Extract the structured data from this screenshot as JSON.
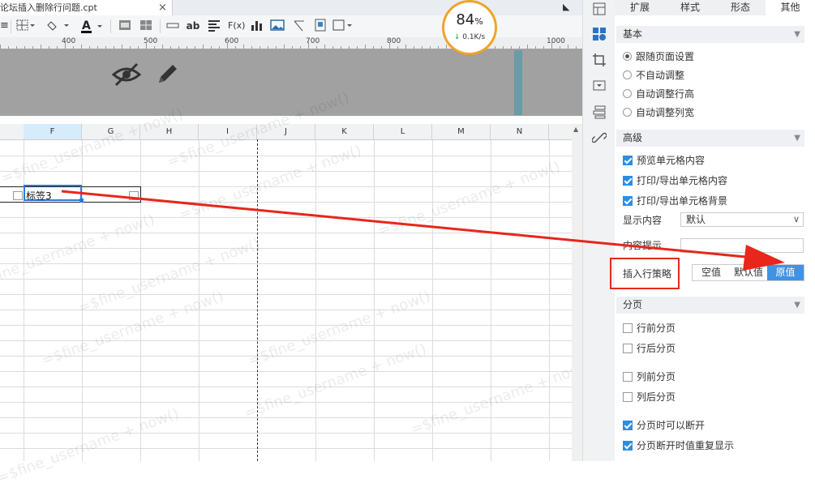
{
  "file_tab": {
    "title": "论坛插入删除行问题.cpt",
    "close": "×"
  },
  "toolbar": {
    "text_ab": "ab",
    "formula": "F(x)"
  },
  "ruler": {
    "labels": [
      "400",
      "500",
      "600",
      "700",
      "800",
      "900",
      "1000"
    ]
  },
  "columns": [
    "F",
    "G",
    "H",
    "I",
    "J",
    "K",
    "L",
    "M",
    "N"
  ],
  "selected_cell": {
    "text": "标签3"
  },
  "watermark": "=$fine_username + now()",
  "speed_widget": {
    "percent": "84",
    "percent_sign": "%",
    "rate": "0.1K/s",
    "rate_arrow": "↓"
  },
  "panel": {
    "tabs": [
      "扩展",
      "样式",
      "形态",
      "其他"
    ],
    "active_tab": "其他",
    "basic": {
      "title": "基本",
      "options": [
        "跟随页面设置",
        "不自动调整",
        "自动调整行高",
        "自动调整列宽"
      ],
      "selected": "跟随页面设置"
    },
    "advanced": {
      "title": "高级",
      "checks": [
        {
          "label": "预览单元格内容",
          "checked": true
        },
        {
          "label": "打印/导出单元格内容",
          "checked": true
        },
        {
          "label": "打印/导出单元格背景",
          "checked": true
        }
      ],
      "display_label": "显示内容",
      "display_value": "默认",
      "tip_label": "内容提示",
      "strategy_label": "插入行策略",
      "strategy_options": [
        "空值",
        "默认值",
        "原值"
      ],
      "strategy_selected": "原值"
    },
    "paging": {
      "title": "分页",
      "checks": [
        {
          "label": "行前分页",
          "checked": false
        },
        {
          "label": "行后分页",
          "checked": false
        },
        {
          "label": "列前分页",
          "checked": false
        },
        {
          "label": "列后分页",
          "checked": false
        },
        {
          "label": "分页时可以断开",
          "checked": true
        },
        {
          "label": "分页断开时值重复显示",
          "checked": true
        }
      ]
    }
  }
}
